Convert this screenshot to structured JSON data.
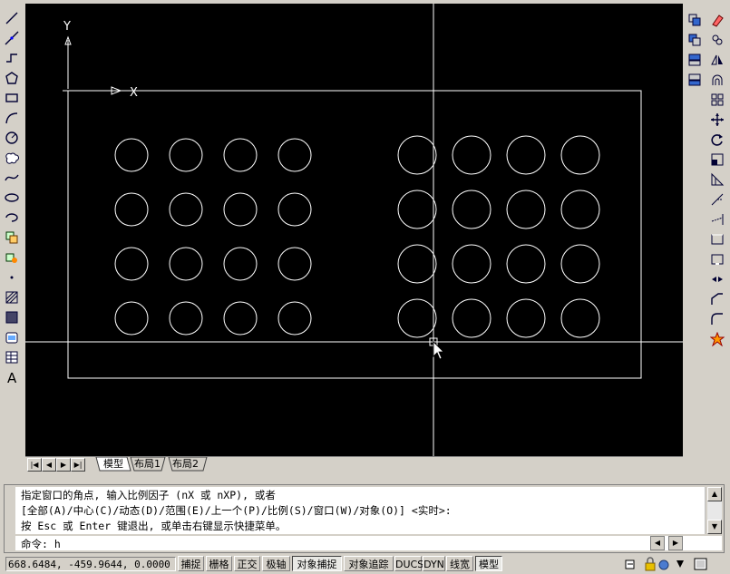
{
  "ucs": {
    "x_label": "X",
    "y_label": "Y"
  },
  "layout_tabs": {
    "model": "模型",
    "layout1": "布局1",
    "layout2": "布局2"
  },
  "nav": {
    "first": "|◀",
    "prev": "◀",
    "next": "▶",
    "last": "▶|"
  },
  "command": {
    "history": [
      "指定窗口的角点, 输入比例因子 (nX 或 nXP), 或者",
      "[全部(A)/中心(C)/动态(D)/范围(E)/上一个(P)/比例(S)/窗口(W)/对象(O)] <实时>:",
      "按 Esc 或 Enter 键退出, 或单击右键显示快捷菜单。"
    ],
    "prompt": "命令: h"
  },
  "status": {
    "coordinates": "668.6484,  -459.9644, 0.0000",
    "buttons": [
      "捕捉",
      "栅格",
      "正交",
      "极轴",
      "对象捕捉",
      "对象追踪",
      "DUCS",
      "DYN",
      "线宽",
      "模型"
    ],
    "active": [
      "对象捕捉",
      "模型"
    ]
  },
  "toolbar_left": [
    "line-icon",
    "construction-line-icon",
    "polyline-icon",
    "polygon-icon",
    "rectangle-icon",
    "arc-icon",
    "circle-icon",
    "revision-cloud-icon",
    "spline-icon",
    "ellipse-icon",
    "ellipse-arc-icon",
    "insert-block-icon",
    "make-block-icon",
    "point-icon",
    "hatch-icon",
    "gradient-icon",
    "region-icon",
    "table-icon",
    "multiline-text-icon"
  ],
  "toolbar_right": [
    "erase-icon",
    "copy-icon",
    "mirror-icon",
    "offset-icon",
    "array-icon",
    "move-icon",
    "rotate-icon",
    "scale-icon",
    "stretch-icon",
    "trim-icon",
    "extend-icon",
    "break-at-point-icon",
    "break-icon",
    "join-icon",
    "chamfer-icon",
    "fillet-icon",
    "explode-icon"
  ],
  "toolbar_right_inner": [
    "draw-order-front-icon",
    "draw-order-back-icon",
    "bring-above-icon",
    "send-under-icon"
  ],
  "colors": {
    "canvas": "#000000",
    "geometry": "#ffffff",
    "ui": "#d4d0c8"
  }
}
